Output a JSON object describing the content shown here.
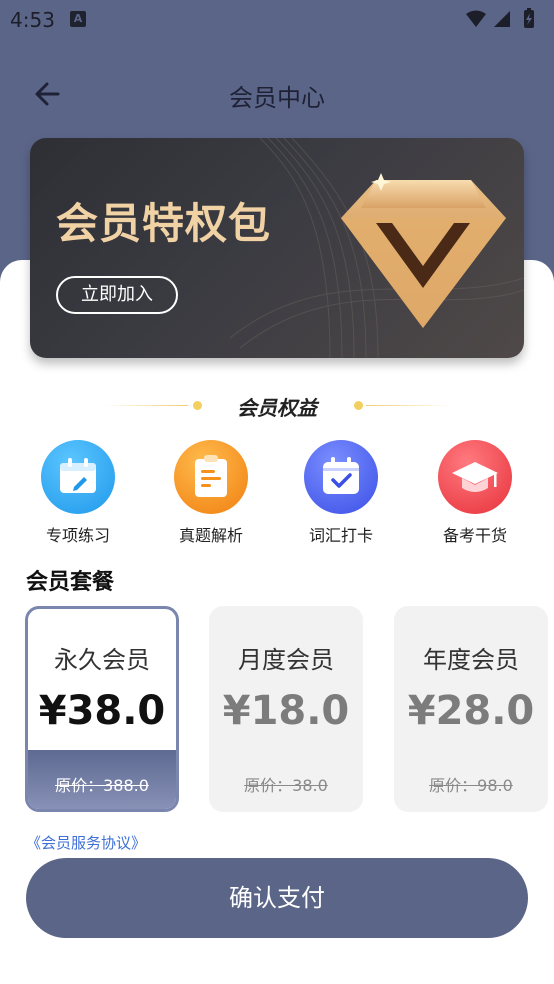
{
  "status_bar": {
    "time": "4:53",
    "notif_letter": "A"
  },
  "header": {
    "title": "会员中心"
  },
  "vip_card": {
    "title": "会员特权包",
    "join_label": "立即加入"
  },
  "benefits": {
    "title": "会员权益",
    "items": [
      {
        "label": "专项练习",
        "icon": "calendar-edit-icon",
        "color": "#2aa8f2"
      },
      {
        "label": "真题解析",
        "icon": "clipboard-icon",
        "color": "#f5921d"
      },
      {
        "label": "词汇打卡",
        "icon": "calendar-check-icon",
        "color": "#4a63f0"
      },
      {
        "label": "备考干货",
        "icon": "graduation-cap-icon",
        "color": "#ef4048"
      }
    ]
  },
  "plans": {
    "title": "会员套餐",
    "items": [
      {
        "name": "永久会员",
        "price": "¥38.0",
        "original": "原价：388.0",
        "selected": true
      },
      {
        "name": "月度会员",
        "price": "¥18.0",
        "original": "原价：38.0",
        "selected": false
      },
      {
        "name": "年度会员",
        "price": "¥28.0",
        "original": "原价：98.0",
        "selected": false
      }
    ]
  },
  "agreement": "《会员服务协议》",
  "pay_button": "确认支付",
  "colors": {
    "header": "#5b6588",
    "gold": "#f0d2a4",
    "link": "#3e6fd6"
  }
}
